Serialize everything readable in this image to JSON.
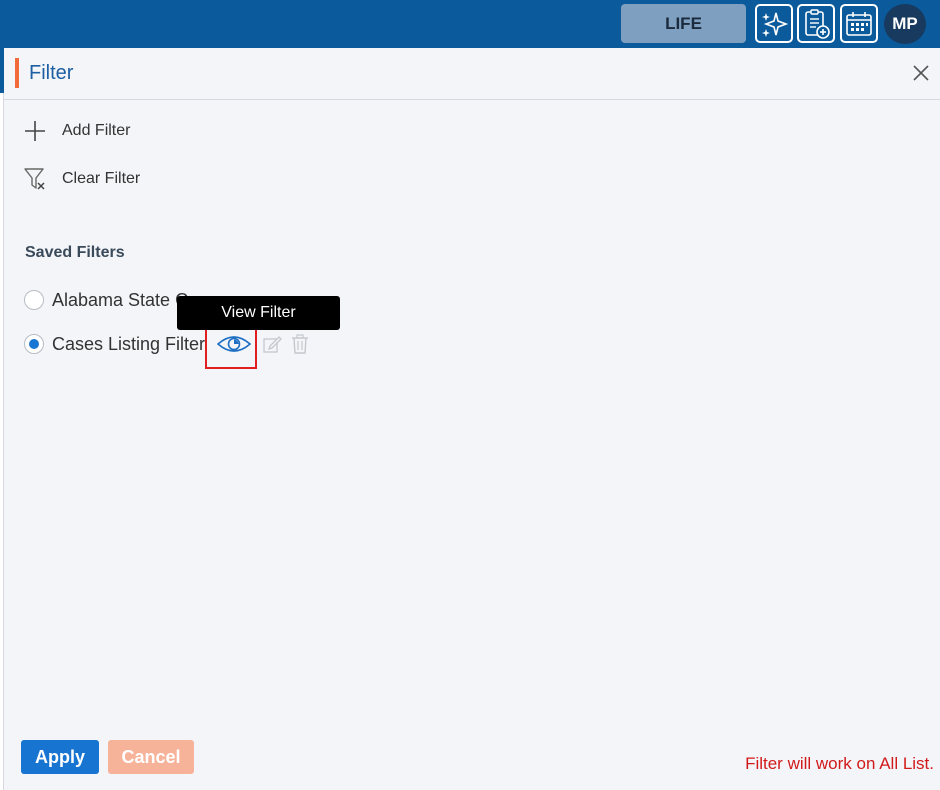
{
  "topbar": {
    "life_label": "LIFE",
    "icons": [
      "sparkle-icon",
      "clipboard-add-icon",
      "calendar-icon"
    ],
    "avatar_initials": "MP",
    "color": "#0a5a9c"
  },
  "panel": {
    "title": "Filter",
    "accent_color": "#f26b3a",
    "actions": {
      "add_label": "Add Filter",
      "clear_label": "Clear Filter"
    },
    "saved_filters_title": "Saved Filters",
    "saved_filters": [
      {
        "label": "Alabama State C",
        "selected": false
      },
      {
        "label": "Cases Listing Filter",
        "selected": true
      }
    ],
    "tooltip": "View Filter",
    "apply_label": "Apply",
    "cancel_label": "Cancel",
    "footer_note": "Filter will work on All List."
  }
}
